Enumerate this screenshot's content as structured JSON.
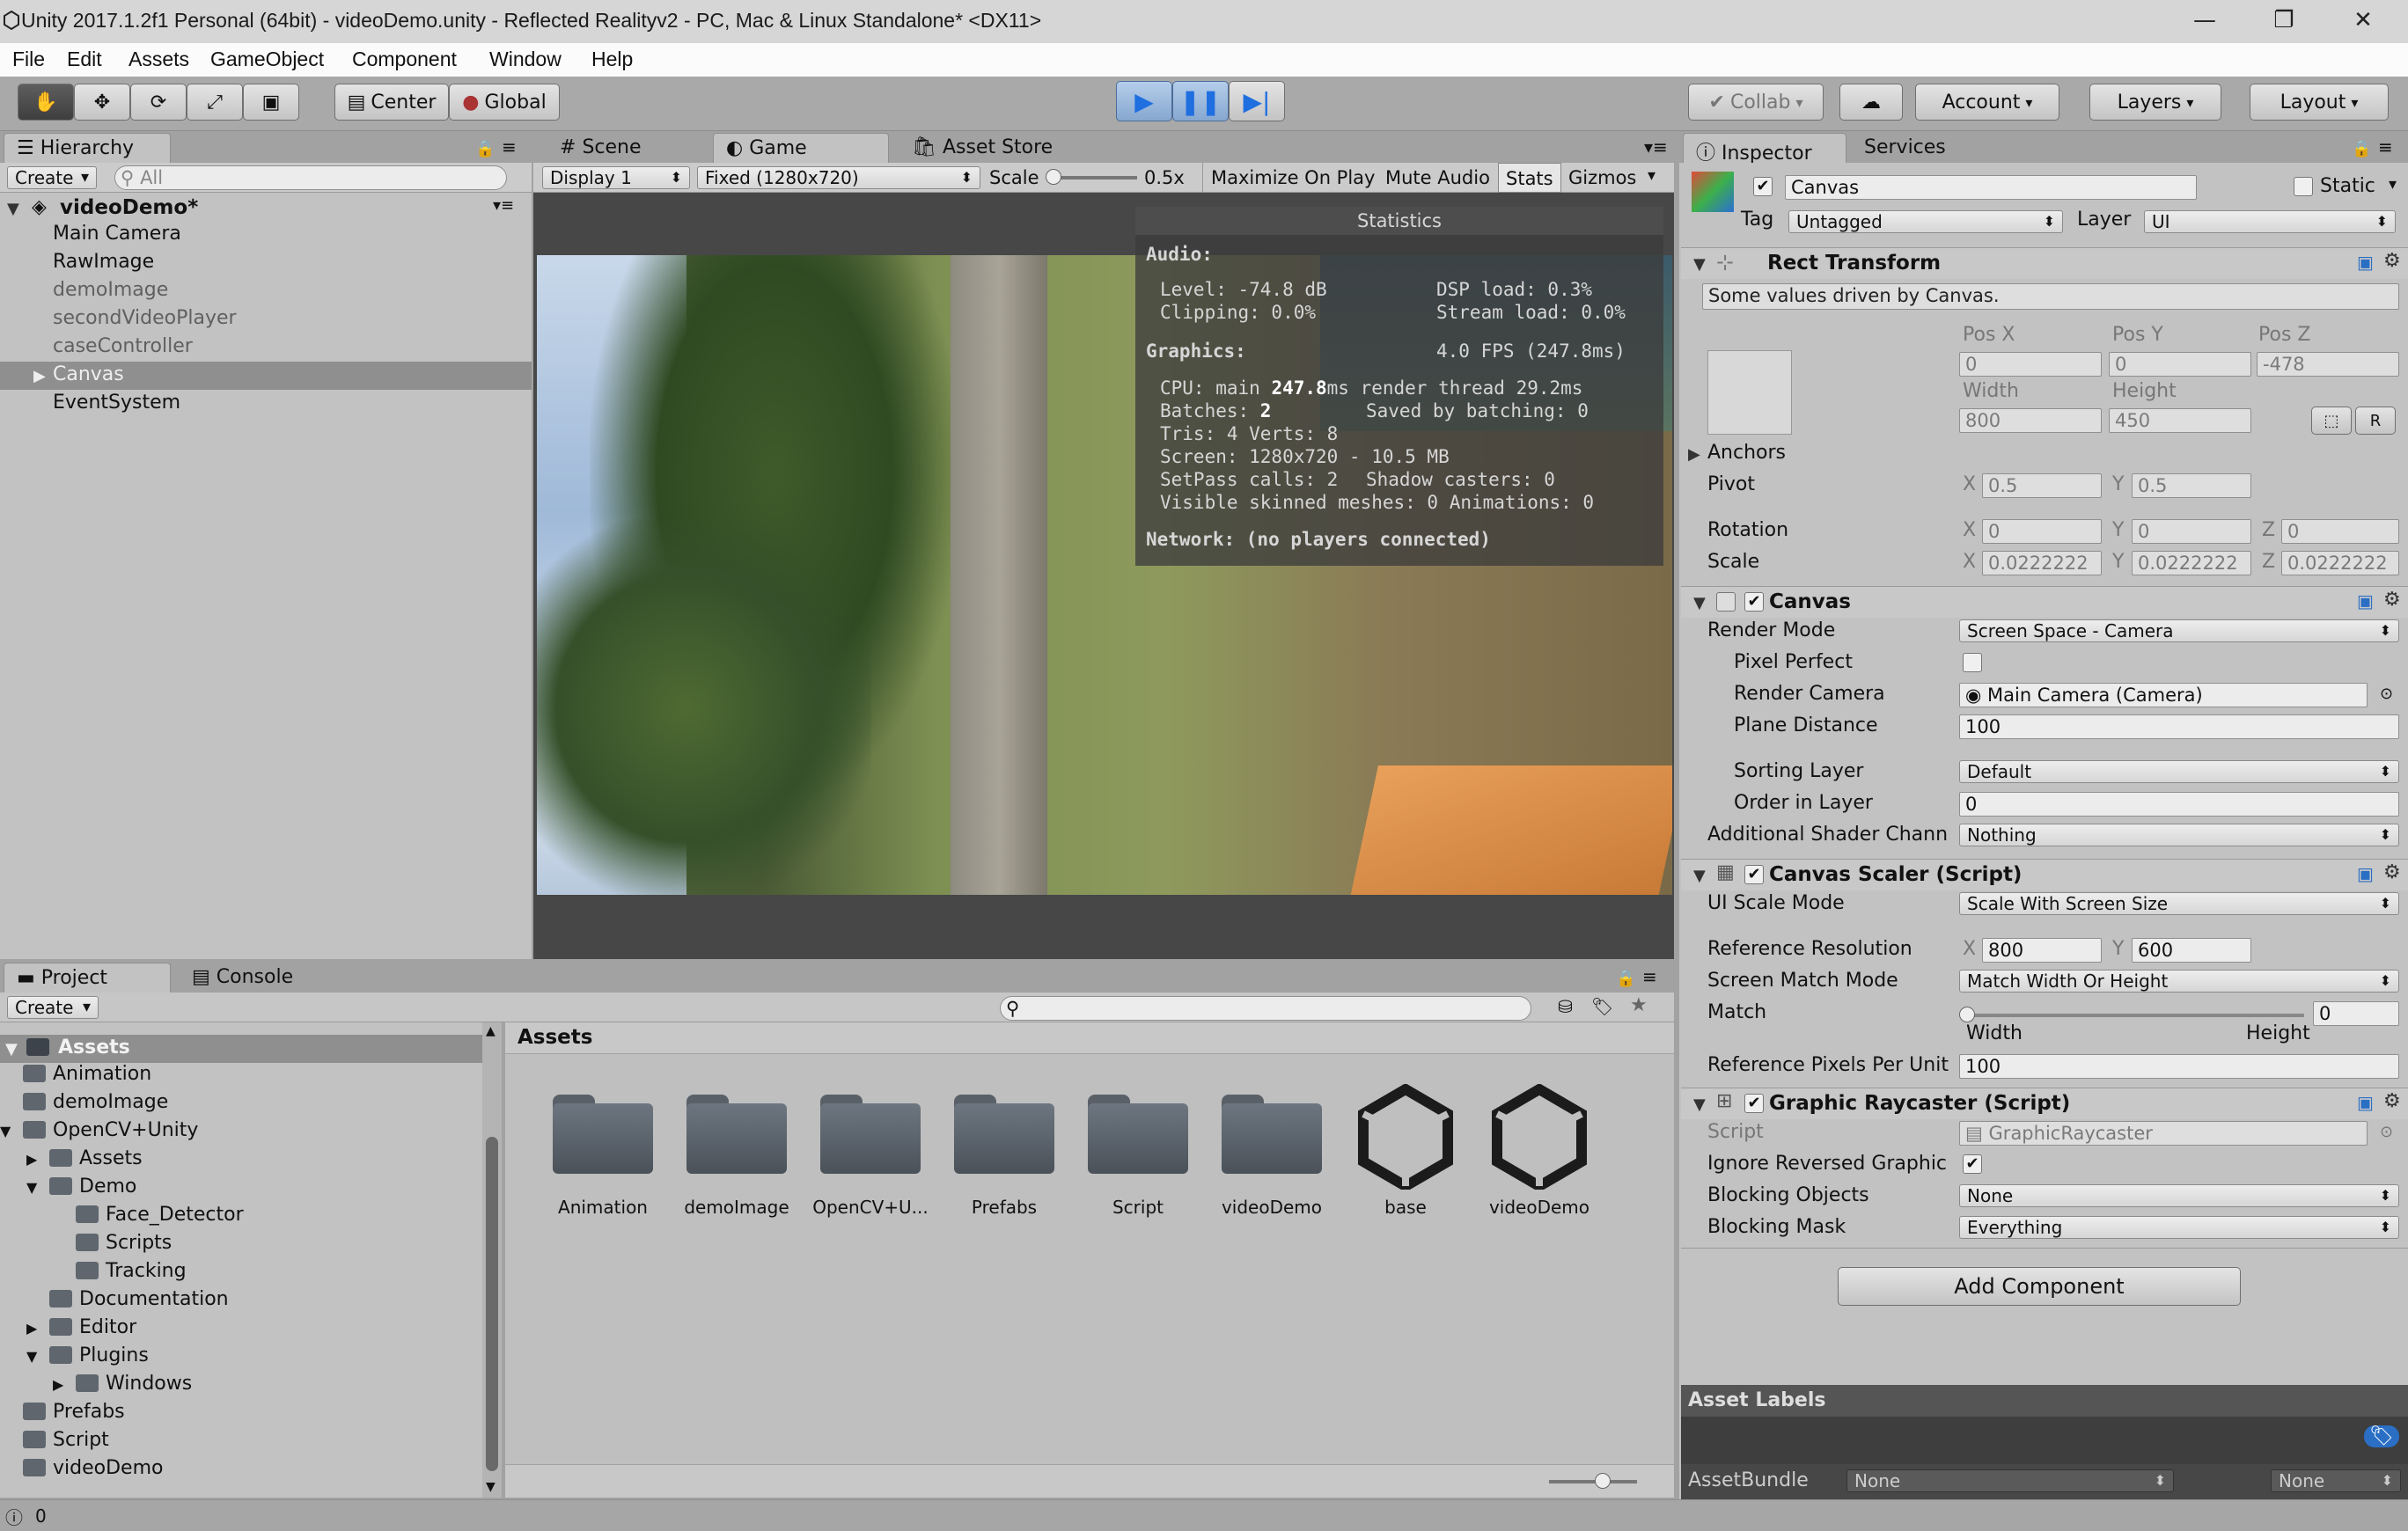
{
  "window": {
    "title": "Unity 2017.1.2f1 Personal (64bit) - videoDemo.unity - Reflected Realityv2 - PC, Mac & Linux Standalone* <DX11>",
    "minimize": "—",
    "maximize": "❐",
    "close": "✕"
  },
  "menu": [
    "File",
    "Edit",
    "Assets",
    "GameObject",
    "Component",
    "Window",
    "Help"
  ],
  "toolbar": {
    "pivot": "Center",
    "space": "Global",
    "collab": "Collab",
    "account": "Account",
    "layers": "Layers",
    "layout": "Layout"
  },
  "hierarchy": {
    "tab": "Hierarchy",
    "create": "Create",
    "search_placeholder": "All",
    "scene": "videoDemo*",
    "items": [
      "Main Camera",
      "RawImage",
      "demoImage",
      "secondVideoPlayer",
      "caseController",
      "Canvas",
      "EventSystem"
    ]
  },
  "scene_tabs": {
    "scene": "Scene",
    "game": "Game",
    "store": "Asset Store"
  },
  "game_bar": {
    "display": "Display 1",
    "resolution": "Fixed (1280x720)",
    "scale_label": "Scale",
    "scale_value": "0.5x",
    "maximize": "Maximize On Play",
    "mute": "Mute Audio",
    "stats": "Stats",
    "gizmos": "Gizmos"
  },
  "stats": {
    "title": "Statistics",
    "audio": "Audio:",
    "level": "Level: -74.8 dB",
    "dsp": "DSP load: 0.3%",
    "clipping": "Clipping: 0.0%",
    "stream": "Stream load: 0.0%",
    "graphics": "Graphics:",
    "fps": "4.0 FPS (247.8ms)",
    "cpu_a": "CPU: main ",
    "cpu_b": "247.8",
    "cpu_c": "ms  render thread 29.2ms",
    "batches_a": "Batches: ",
    "batches_b": "2",
    "saved": "Saved by batching: 0",
    "tris": "Tris: 4     Verts: 8",
    "screen": "Screen: 1280x720 - 10.5 MB",
    "setpass": "SetPass calls: 2",
    "shadow": "Shadow casters: 0",
    "skinned": "Visible skinned meshes: 0  Animations: 0",
    "network": "Network: (no players connected)"
  },
  "inspector": {
    "tab": "Inspector",
    "services": "Services",
    "name": "Canvas",
    "static": "Static",
    "tag_label": "Tag",
    "tag": "Untagged",
    "layer_label": "Layer",
    "layer": "UI",
    "rect": {
      "title": "Rect Transform",
      "note": "Some values driven by Canvas.",
      "posx_l": "Pos X",
      "posy_l": "Pos Y",
      "posz_l": "Pos Z",
      "posx": "0",
      "posy": "0",
      "posz": "-478",
      "width_l": "Width",
      "height_l": "Height",
      "width": "800",
      "height": "450",
      "anchors": "Anchors",
      "pivot": "Pivot",
      "pivot_x": "0.5",
      "pivot_y": "0.5",
      "rotation": "Rotation",
      "rot_x": "0",
      "rot_y": "0",
      "rot_z": "0",
      "scale": "Scale",
      "scale_x": "0.0222222",
      "scale_y": "0.0222222",
      "scale_z": "0.0222222",
      "x": "X",
      "y": "Y",
      "z": "Z",
      "r": "R"
    },
    "canvas": {
      "title": "Canvas",
      "render_mode_l": "Render Mode",
      "render_mode": "Screen Space - Camera",
      "pixel_perfect": "Pixel Perfect",
      "render_camera_l": "Render Camera",
      "render_camera": "Main Camera (Camera)",
      "plane_distance_l": "Plane Distance",
      "plane_distance": "100",
      "sorting_layer_l": "Sorting Layer",
      "sorting_layer": "Default",
      "order_l": "Order in Layer",
      "order": "0",
      "shader_l": "Additional Shader Chann",
      "shader": "Nothing"
    },
    "scaler": {
      "title": "Canvas Scaler (Script)",
      "mode_l": "UI Scale Mode",
      "mode": "Scale With Screen Size",
      "refres_l": "Reference Resolution",
      "ref_x": "800",
      "ref_y": "600",
      "match_mode_l": "Screen Match Mode",
      "match_mode": "Match Width Or Height",
      "match_l": "Match",
      "match": "0",
      "width": "Width",
      "height": "Height",
      "ppu_l": "Reference Pixels Per Unit",
      "ppu": "100"
    },
    "raycaster": {
      "title": "Graphic Raycaster (Script)",
      "script_l": "Script",
      "script": "GraphicRaycaster",
      "ignore_l": "Ignore Reversed Graphic",
      "blocking_l": "Blocking Objects",
      "blocking": "None",
      "mask_l": "Blocking Mask",
      "mask": "Everything"
    },
    "add_component": "Add Component",
    "asset_labels": "Asset Labels",
    "assetbundle": "AssetBundle",
    "ab_name": "None",
    "ab_variant": "None"
  },
  "project": {
    "tab": "Project",
    "console": "Console",
    "create": "Create",
    "root": "Assets",
    "tree": [
      {
        "label": "Animation",
        "indent": 1,
        "arrow": ""
      },
      {
        "label": "demoImage",
        "indent": 1,
        "arrow": ""
      },
      {
        "label": "OpenCV+Unity",
        "indent": 1,
        "arrow": "▼"
      },
      {
        "label": "Assets",
        "indent": 2,
        "arrow": "▶"
      },
      {
        "label": "Demo",
        "indent": 2,
        "arrow": "▼"
      },
      {
        "label": "Face_Detector",
        "indent": 3,
        "arrow": ""
      },
      {
        "label": "Scripts",
        "indent": 3,
        "arrow": ""
      },
      {
        "label": "Tracking",
        "indent": 3,
        "arrow": ""
      },
      {
        "label": "Documentation",
        "indent": 2,
        "arrow": ""
      },
      {
        "label": "Editor",
        "indent": 2,
        "arrow": "▶"
      },
      {
        "label": "Plugins",
        "indent": 2,
        "arrow": "▼"
      },
      {
        "label": "Windows",
        "indent": 3,
        "arrow": "▶"
      },
      {
        "label": "Prefabs",
        "indent": 1,
        "arrow": ""
      },
      {
        "label": "Script",
        "indent": 1,
        "arrow": ""
      },
      {
        "label": "videoDemo",
        "indent": 1,
        "arrow": ""
      }
    ],
    "breadcrumb": "Assets",
    "assets": [
      {
        "label": "Animation",
        "type": "folder"
      },
      {
        "label": "demoImage",
        "type": "folder"
      },
      {
        "label": "OpenCV+U...",
        "type": "folder"
      },
      {
        "label": "Prefabs",
        "type": "folder"
      },
      {
        "label": "Script",
        "type": "folder"
      },
      {
        "label": "videoDemo",
        "type": "folder"
      },
      {
        "label": "base",
        "type": "unity"
      },
      {
        "label": "videoDemo",
        "type": "unity"
      }
    ]
  },
  "statusbar": {
    "count": "0"
  }
}
